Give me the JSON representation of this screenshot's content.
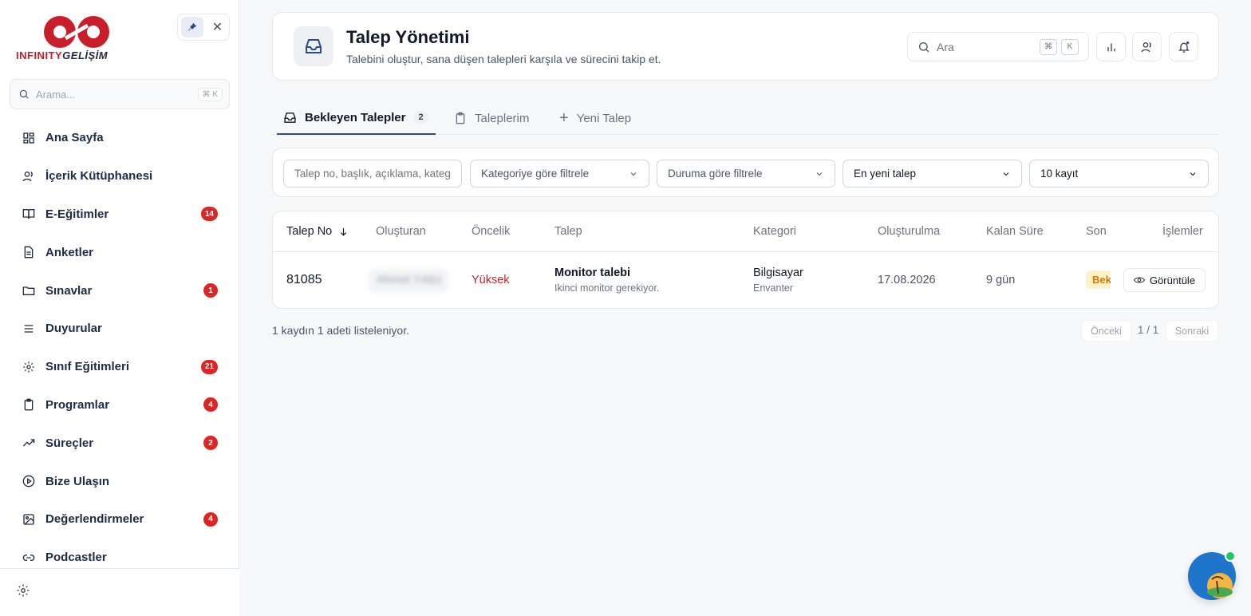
{
  "brand": {
    "logo_main": "INFINITY",
    "logo_accent": "GELİŞİM",
    "primary_color": "#c81e2b"
  },
  "sidebar": {
    "search_placeholder": "Arama...",
    "search_shortcut": "⌘ K",
    "items": [
      {
        "label": "Ana Sayfa",
        "icon": "grid-icon",
        "badge": ""
      },
      {
        "label": "İçerik Kütüphanesi",
        "icon": "users-icon",
        "badge": ""
      },
      {
        "label": "E-Eğitimler",
        "icon": "book-icon",
        "badge": "14"
      },
      {
        "label": "Anketler",
        "icon": "document-icon",
        "badge": ""
      },
      {
        "label": "Sınavlar",
        "icon": "folder-icon",
        "badge": "1"
      },
      {
        "label": "Duyurular",
        "icon": "menu-icon",
        "badge": ""
      },
      {
        "label": "Sınıf Eğitimleri",
        "icon": "gear-icon",
        "badge": "21"
      },
      {
        "label": "Programlar",
        "icon": "clipboard-icon",
        "badge": "4"
      },
      {
        "label": "Süreçler",
        "icon": "trending-icon",
        "badge": "2"
      },
      {
        "label": "Bize Ulaşın",
        "icon": "play-circle-icon",
        "badge": ""
      },
      {
        "label": "Değerlendirmeler",
        "icon": "image-icon",
        "badge": "4"
      },
      {
        "label": "Podcastler",
        "icon": "link-icon",
        "badge": ""
      }
    ]
  },
  "header": {
    "title": "Talep Yönetimi",
    "subtitle": "Talebini oluştur, sana düşen talepleri karşıla ve sürecini takip et.",
    "search_placeholder": "Ara",
    "kbd_1": "⌘",
    "kbd_2": "K"
  },
  "tabs": [
    {
      "label": "Bekleyen Talepler",
      "count": "2",
      "active": true
    },
    {
      "label": "Taleplerim",
      "count": "",
      "active": false
    },
    {
      "label": "Yeni Talep",
      "count": "",
      "active": false
    }
  ],
  "filters": {
    "search_placeholder": "Talep no, başlık, açıklama, kategori",
    "category": "Kategoriye göre filtrele",
    "status": "Duruma göre filtrele",
    "sort": "En yeni talep",
    "page_size": "10 kayıt"
  },
  "table": {
    "columns": [
      "Talep No",
      "Oluşturan",
      "Öncelik",
      "Talep",
      "Kategori",
      "Oluşturulma",
      "Kalan Süre",
      "Son D",
      "İşlemler"
    ],
    "rows": [
      {
        "no": "81085",
        "creator": "Ahmet Yıldız",
        "priority": "Yüksek",
        "title": "Monitor talebi",
        "description": "Ikinci monitor gerekiyor.",
        "category": "Bilgisayar",
        "subcategory": "Envanter",
        "created": "17.08.2026",
        "remaining": "9 gün",
        "status": "Bekliyor",
        "action": "Görüntüle"
      }
    ],
    "priority_color": "#c0262d",
    "status_color": "#d97706"
  },
  "footer": {
    "summary": "1 kaydın 1 adeti listeleniyor.",
    "prev": "Önceki",
    "page": "1 / 1",
    "next": "Sonraki"
  }
}
